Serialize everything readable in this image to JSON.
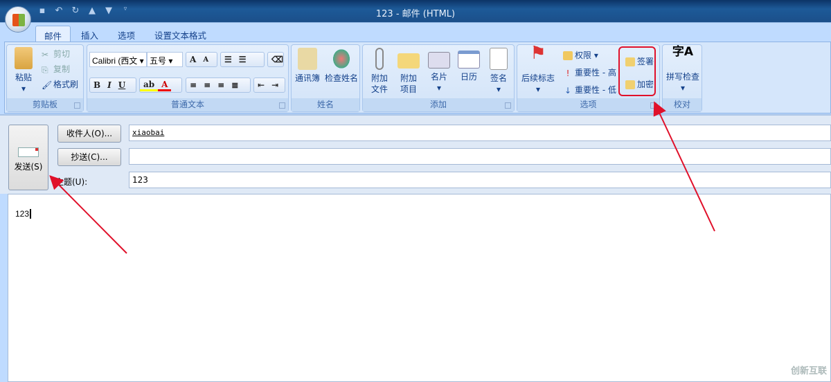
{
  "window": {
    "title": "123 - 邮件 (HTML)"
  },
  "quick_access": [
    "save-icon",
    "undo-icon",
    "redo-icon",
    "up-icon",
    "down-icon",
    "customize-icon"
  ],
  "tabs": [
    {
      "label": "邮件",
      "active": true
    },
    {
      "label": "插入"
    },
    {
      "label": "选项"
    },
    {
      "label": "设置文本格式"
    }
  ],
  "ribbon": {
    "clipboard": {
      "label": "剪贴板",
      "paste": "粘贴",
      "cut": "剪切",
      "copy": "复制",
      "format_painter": "格式刷"
    },
    "basic_text": {
      "label": "普通文本",
      "font": "Calibri (西文",
      "size": "五号",
      "bold": "B",
      "italic": "I",
      "underline": "U"
    },
    "names": {
      "label": "姓名",
      "address_book": "通讯簿",
      "check_names": "检查姓名"
    },
    "include": {
      "label": "添加",
      "attach_file": "附加\n文件",
      "attach_item_1": "附加",
      "attach_item_2": "项目",
      "attach_file_1": "附加",
      "attach_file_2": "文件",
      "business_card": "名片",
      "calendar": "日历",
      "signature": "签名"
    },
    "options": {
      "label": "选项",
      "follow_up": "后续标志",
      "permission": "权限",
      "high_importance": "重要性 - 高",
      "low_importance": "重要性 - 低",
      "sign": "签署",
      "encrypt": "加密"
    },
    "proofing": {
      "label": "校对",
      "spelling": "拼写检查"
    }
  },
  "compose": {
    "send": "发送(S)",
    "to_button": "收件人(O)...",
    "to_value": "xiaobai",
    "cc_button": "抄送(C)...",
    "cc_value": "",
    "subject_label": "主题(U):",
    "subject_value": "123",
    "body_text": "123"
  },
  "watermark": "创新互联",
  "colors": {
    "titlebar": "#1b4f8a",
    "ribbon": "#bfdbff",
    "annotation": "#e0102a"
  }
}
